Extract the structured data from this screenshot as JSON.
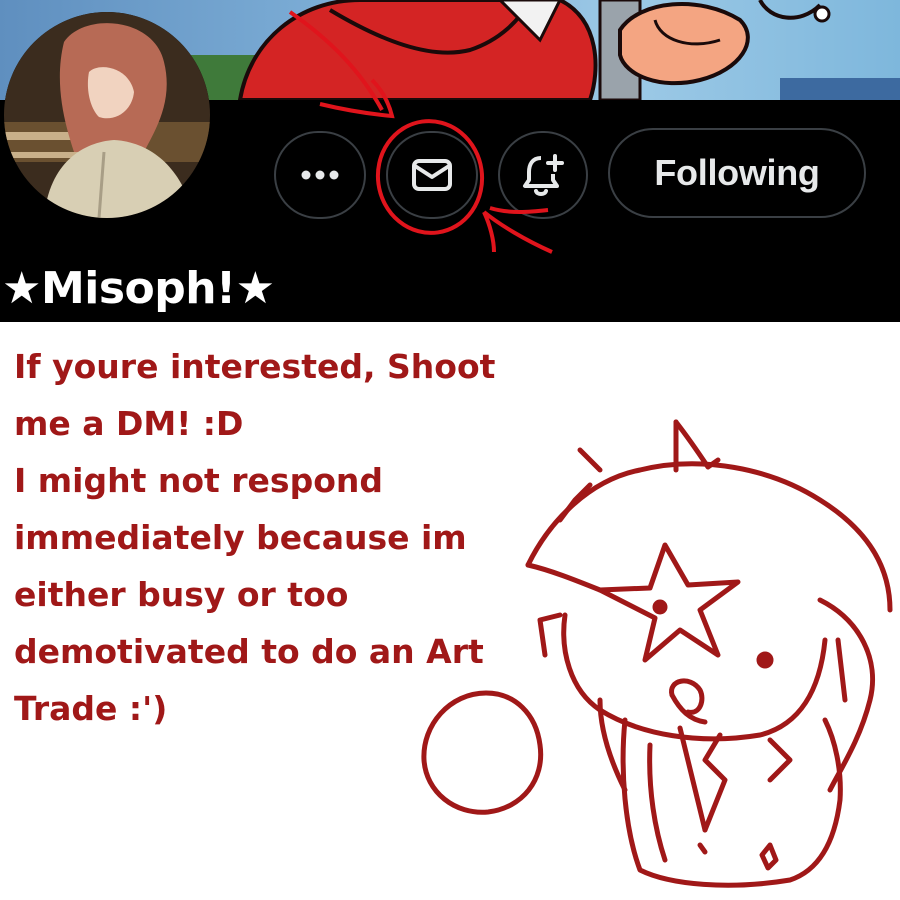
{
  "profile": {
    "display_name": "★Misoph!★",
    "actions": {
      "more_icon": "ellipsis-icon",
      "message_icon": "envelope-icon",
      "notify_icon": "bell-plus-icon",
      "following_label": "Following"
    }
  },
  "message": {
    "lines": [
      "If youre interested, Shoot",
      "me a DM! :D",
      "I might not respond",
      "immediately because im",
      "either busy or too",
      "demotivated to do an Art",
      "Trade :')"
    ]
  },
  "colors": {
    "ink_red": "#a01818",
    "annotation_red": "#e0141c",
    "profile_bg": "#000000",
    "button_border": "#3a3f44",
    "button_text": "#e7e9ea"
  }
}
